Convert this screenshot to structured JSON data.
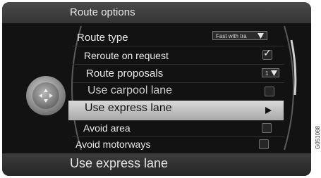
{
  "header": {
    "title": "Route options"
  },
  "menu": {
    "route_type": {
      "label": "Route type",
      "value": "Fast with tra"
    },
    "reroute_on_request": {
      "label": "Reroute on request",
      "checked": true
    },
    "route_proposals": {
      "label": "Route proposals",
      "value": "1"
    },
    "use_carpool_lane": {
      "label": "Use carpool lane",
      "checked": false
    },
    "use_express_lane": {
      "label": "Use express lane",
      "selected": true
    },
    "avoid_area": {
      "label": "Avoid area",
      "checked": false
    },
    "avoid_motorways": {
      "label": "Avoid motorways",
      "checked": false
    }
  },
  "footer": {
    "text": "Use express lane"
  },
  "figure_id": "G051088",
  "icons": {
    "knob": "rotary-controller-icon",
    "submenu_arrow": "triangle-right-icon",
    "dropdown_arrow": "triangle-down-icon",
    "check": "checkmark-icon"
  }
}
